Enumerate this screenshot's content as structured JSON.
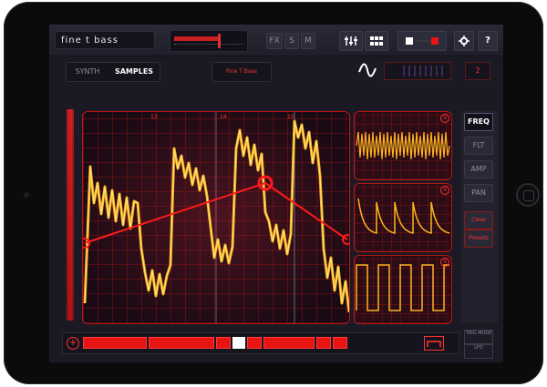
{
  "app": {
    "preset_name": "fine t bass"
  },
  "toolbar": {
    "fx_label": "FX",
    "s_label": "S",
    "m_label": "M",
    "help_label": "?",
    "volume_level": 0.6
  },
  "tabs": {
    "synth_label": "SYNTH",
    "samples_label": "SAMPLES",
    "sample_name": "Fine T Bass",
    "octave": "2"
  },
  "graph": {
    "markers": [
      "13",
      "14",
      "15"
    ]
  },
  "side_panel": {
    "freq_label": "FREQ",
    "flt_label": "FLT",
    "amp_label": "AMP",
    "pan_label": "PAN",
    "clear_label": "Clear",
    "presets_label": "Presets",
    "bottom_label_1": "TRIG MODE",
    "bottom_label_2": "LFO"
  },
  "colors": {
    "accent": "#ff2020",
    "waveform": "#ffb020",
    "background": "#1b1a24"
  },
  "icons": {
    "mixer": "sliders-icon",
    "grid": "grid-icon",
    "settings": "gear-icon",
    "wave": "sine-wave-icon"
  }
}
